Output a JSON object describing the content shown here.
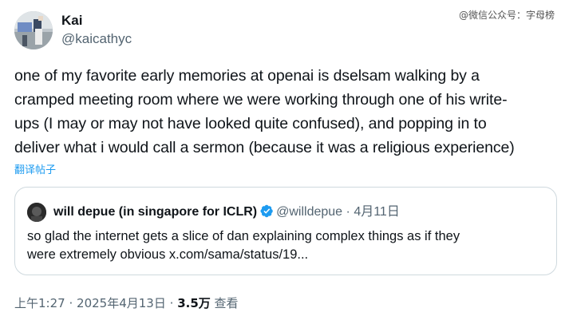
{
  "author": {
    "name": "Kai",
    "handle": "@kaicathyc"
  },
  "watermark": "@微信公众号：字母榜",
  "tweet_lines": [
    "one of my favorite early memories at openai is dselsam walking by a",
    "cramped meeting room where we were working through one of his write-",
    "ups (I may or may not have looked quite confused), and popping in to",
    "deliver what i would call a sermon (because it was a religious experience)"
  ],
  "translate_label": "翻译帖子",
  "quoted": {
    "name": "will depue (in singapore for ICLR)",
    "handle": "@willdepue",
    "separator": "·",
    "date": "4月11日",
    "text_lines": [
      "so glad the internet gets a slice of dan explaining complex things as if they",
      "were extremely obvious x.com/sama/status/19..."
    ]
  },
  "meta": {
    "time": "上午1:27",
    "sep1": "·",
    "date": "2025年4月13日",
    "sep2": "·",
    "views_count": "3.5万",
    "views_label": "查看"
  },
  "colors": {
    "link": "#1d9bf0",
    "secondary": "#536471",
    "text": "#0f1419",
    "verified": "#1d9bf0",
    "border": "#cfd9de"
  }
}
